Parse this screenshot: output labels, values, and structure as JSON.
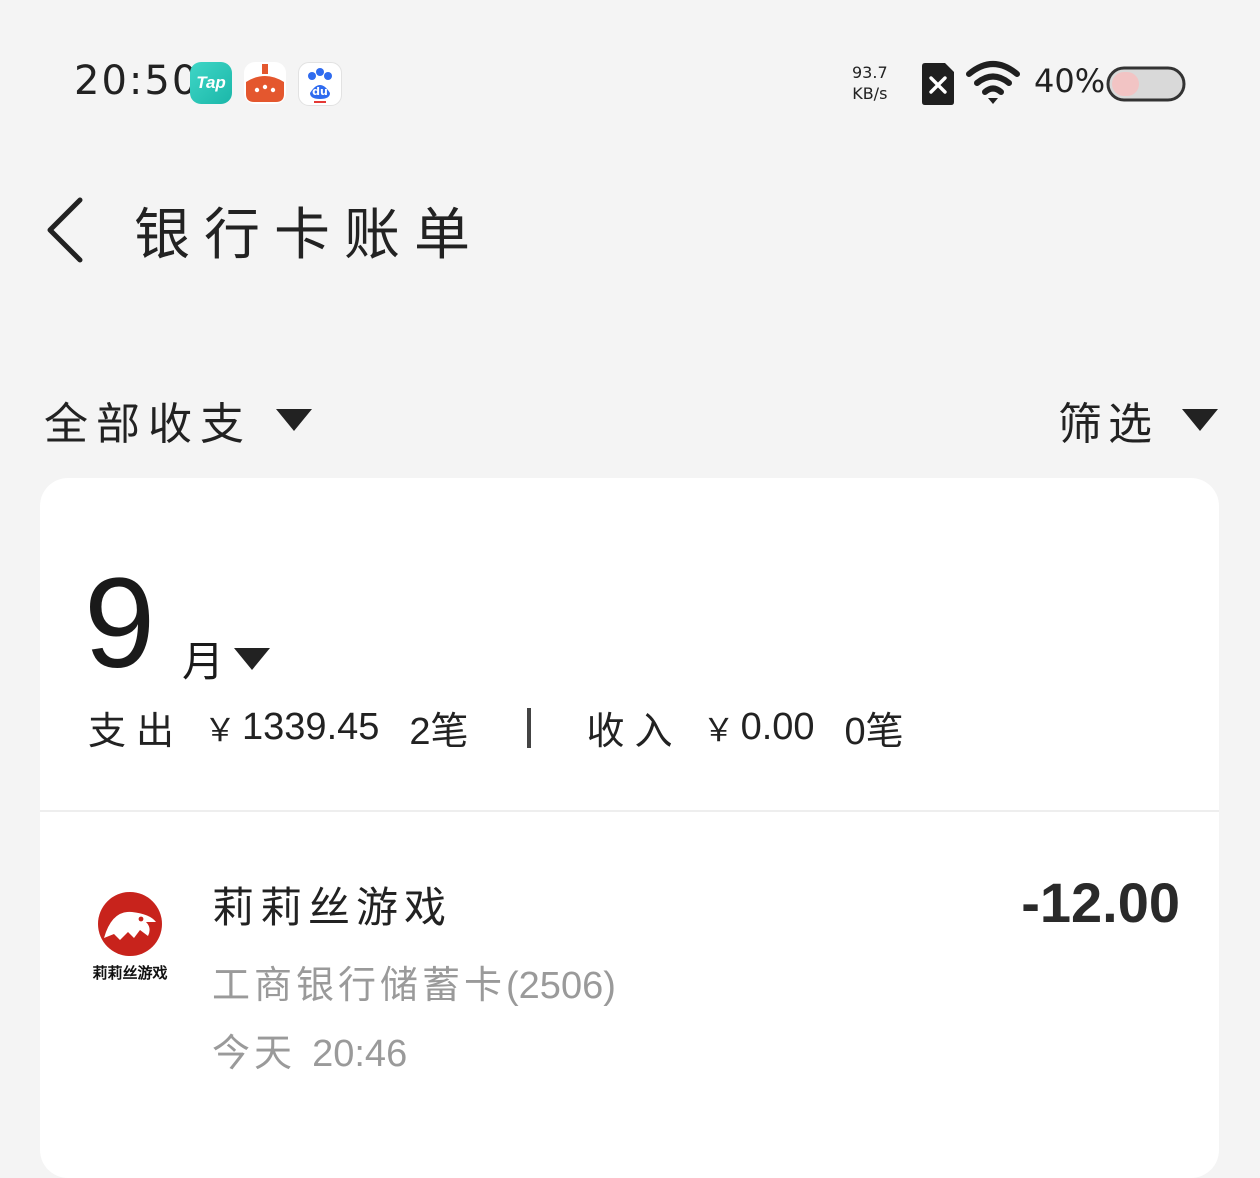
{
  "status_bar": {
    "time": "20:50",
    "apps": [
      {
        "name": "tap-icon",
        "label": "Tap"
      },
      {
        "name": "fruit-app-icon"
      },
      {
        "name": "baidu-icon",
        "label": "du"
      }
    ],
    "net_speed_value": "93.7",
    "net_speed_unit": "KB/s",
    "battery_percent": "40%",
    "battery_level": 0.4
  },
  "header": {
    "back_icon": "chevron-left-icon",
    "title": "银行卡账单"
  },
  "filters": {
    "all_label": "全部收支",
    "filter_label": "筛选"
  },
  "summary": {
    "month_number": "9",
    "month_unit": "月",
    "expense_label": "支出",
    "expense_currency": "￥",
    "expense_amount": "1339.45",
    "expense_count": "2笔",
    "income_label": "收入",
    "income_currency": "￥",
    "income_amount": "0.00",
    "income_count": "0笔"
  },
  "transactions": [
    {
      "merchant": "莉莉丝游戏",
      "logo_text": "莉莉丝游戏",
      "amount": "-12.00",
      "card_name": "工商银行储蓄卡",
      "card_suffix": "(2506)",
      "day": "今天",
      "time": "20:46"
    }
  ],
  "colors": {
    "background": "#f4f4f4",
    "card": "#ffffff",
    "lilith_red": "#c8231c",
    "secondary_text": "#9a9a9a"
  }
}
